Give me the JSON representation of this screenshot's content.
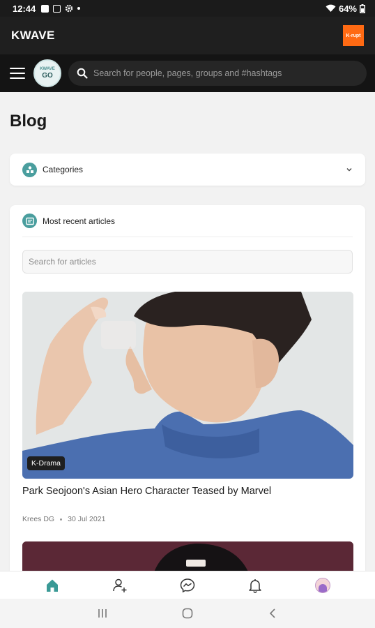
{
  "status_bar": {
    "time": "12:44",
    "battery": "64%",
    "icons": [
      "gallery-icon",
      "sim-icon",
      "settings-icon",
      "dot-icon",
      "wifi-icon",
      "battery-icon"
    ]
  },
  "app_bar": {
    "title": "KWAVE",
    "promo_label": "K-rupt"
  },
  "search_bar": {
    "logo_top": "KWAVE",
    "logo_bottom": "GO",
    "placeholder": "Search for people, pages, groups and #hashtags"
  },
  "page": {
    "title": "Blog"
  },
  "categories": {
    "label": "Categories",
    "icon": "categories-icon"
  },
  "recent": {
    "label": "Most recent articles",
    "icon": "articles-icon",
    "search_placeholder": "Search for articles"
  },
  "articles": [
    {
      "category": "K-Drama",
      "title": "Park Seojoon's Asian Hero Character Teased by Marvel",
      "author": "Krees DG",
      "date": "30 Jul 2021"
    }
  ],
  "bottom_nav": {
    "items": [
      "home-icon",
      "add-friend-icon",
      "messenger-icon",
      "notifications-icon",
      "profile-avatar"
    ],
    "active_color": "#3a9a96"
  },
  "colors": {
    "accent": "#4a9e9e",
    "dark_header": "#1f1f1f",
    "promo": "#ff6a13"
  }
}
